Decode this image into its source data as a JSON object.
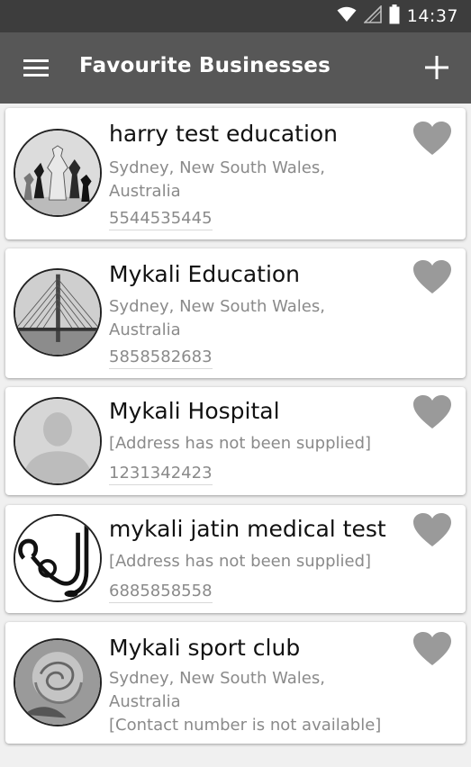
{
  "status_bar": {
    "time": "14:37",
    "icons": [
      "wifi-icon",
      "signal-icon",
      "battery-icon"
    ]
  },
  "app_bar": {
    "title": "Favourite Businesses",
    "menu_icon": "hamburger-menu-icon",
    "add_icon": "plus-icon"
  },
  "colors": {
    "status_bar": "#3d3d3d",
    "app_bar": "#575757",
    "heart": "#9a9a9a",
    "secondary_text": "#8a8a8a"
  },
  "businesses": [
    {
      "name": "harry test education",
      "address_line1": "Sydney, New South Wales,",
      "address_line2": "Australia",
      "contact": "5544535445",
      "avatar": "chess-pieces-photo",
      "favourite_icon": "heart-icon"
    },
    {
      "name": "Mykali Education",
      "address_line1": "Sydney, New South Wales,",
      "address_line2": "Australia",
      "contact": "5858582683",
      "avatar": "bridge-cables-photo",
      "favourite_icon": "heart-icon"
    },
    {
      "name": "Mykali Hospital",
      "address_line1": "[Address has not been supplied]",
      "address_line2": "",
      "contact": "1231342423",
      "avatar": "default-person-avatar",
      "favourite_icon": "heart-icon"
    },
    {
      "name": "mykali jatin medical test",
      "address_line1": "[Address has not been supplied]",
      "address_line2": "",
      "contact": "6885858558",
      "avatar": "stethoscope-photo",
      "favourite_icon": "heart-icon"
    },
    {
      "name": "Mykali sport club",
      "address_line1": "Sydney, New South Wales,",
      "address_line2": "Australia",
      "contact": "[Contact number is not available]",
      "avatar": "rose-photo",
      "favourite_icon": "heart-icon"
    }
  ]
}
